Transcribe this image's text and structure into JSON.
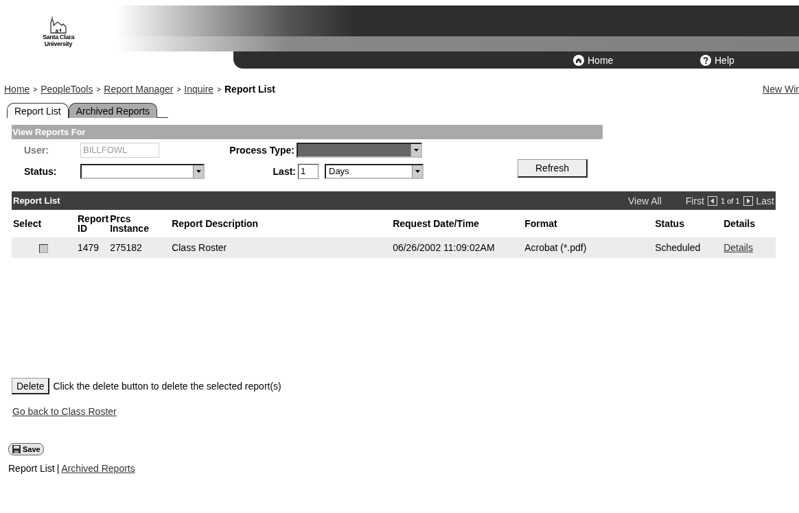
{
  "logo": {
    "line1": "Santa Clara",
    "line2": "University"
  },
  "header_links": [
    {
      "kind": "home",
      "label": "Home"
    },
    {
      "kind": "help",
      "label": "Help"
    }
  ],
  "breadcrumb": {
    "links": [
      "Home",
      "PeopleTools",
      "Report Manager",
      "Inquire"
    ],
    "separator": ">",
    "current": "Report List"
  },
  "new_window": "New Wir",
  "tabs": [
    {
      "label": "Report List",
      "selected": true
    },
    {
      "label": "Archived Reports",
      "selected": false
    }
  ],
  "filter": {
    "title": "View Reports For",
    "user_label": "User:",
    "user_value": "BILLFOWL",
    "process_type_label": "Process Type:",
    "status_label": "Status:",
    "last_label": "Last:",
    "last_value": "1",
    "last_unit": "Days",
    "refresh": "Refresh"
  },
  "report_list": {
    "title": "Report List",
    "view_all": "View All",
    "first": "First",
    "page": "1 of 1",
    "last": "Last",
    "columns": [
      [
        "Select"
      ],
      [
        "Report",
        "ID"
      ],
      [
        "Prcs",
        "Instance"
      ],
      [
        "Report Description"
      ],
      [
        "Request Date/Time"
      ],
      [
        "Format"
      ],
      [
        "Status"
      ],
      [
        "Details"
      ]
    ],
    "rows": [
      {
        "checked": false,
        "report_id": "1479",
        "instance": "275182",
        "description": "Class Roster",
        "requested": "06/26/2002 11:09:02AM",
        "format": "Acrobat (*.pdf)",
        "status": "Scheduled",
        "details": "Details"
      }
    ]
  },
  "delete_button": "Delete",
  "delete_hint": "Click the delete button to delete the selected report(s)",
  "back_link": "Go back to Class Roster",
  "save_button": "Save",
  "footer_links": [
    {
      "label": "Report List",
      "selected": true
    },
    {
      "label": "Archived Reports",
      "selected": false
    }
  ],
  "footer_separator": "|"
}
